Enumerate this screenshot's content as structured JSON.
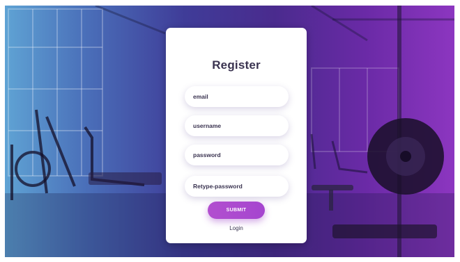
{
  "form": {
    "title": "Register",
    "fields": {
      "email": {
        "placeholder": "email",
        "value": ""
      },
      "username": {
        "placeholder": "username",
        "value": ""
      },
      "password": {
        "placeholder": "password",
        "value": ""
      },
      "retype_password": {
        "placeholder": "Retype-password",
        "value": ""
      }
    },
    "submit_label": "SUBMIT",
    "login_label": "Login"
  },
  "colors": {
    "accent": "#a545cf",
    "title_text": "#3a3350",
    "overlay_left": "#5fa3d4",
    "overlay_right": "#8c36c0"
  },
  "background": {
    "icon": "gym-interior-photo"
  }
}
